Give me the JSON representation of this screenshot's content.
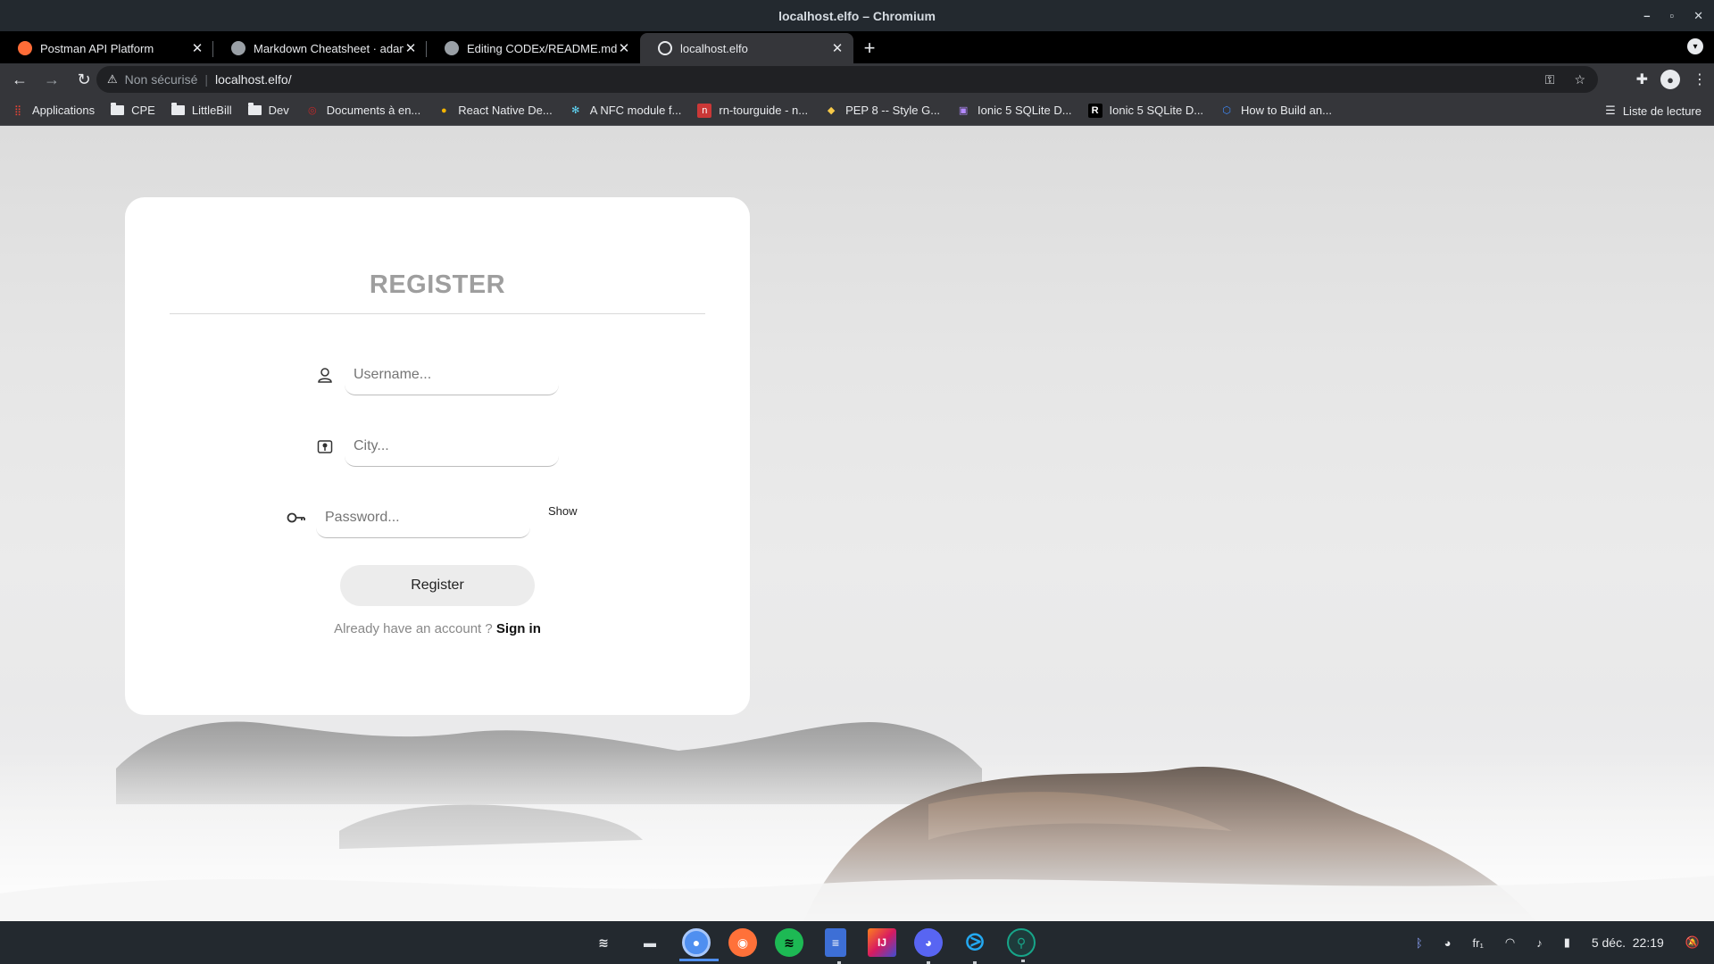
{
  "window": {
    "title": "localhost.elfo – Chromium",
    "controls": [
      "–",
      "▫",
      "✕"
    ]
  },
  "tabs": [
    {
      "label": "Postman API Platform",
      "favicon_color": "#ff6c37",
      "favicon_glyph": "⬤",
      "active": false
    },
    {
      "label": "Markdown Cheatsheet · adam-p/markdown-here",
      "favicon_color": "#24292f",
      "favicon_glyph": "◉",
      "active": false
    },
    {
      "label": "Editing CODEx/README.md at main",
      "favicon_color": "#24292f",
      "favicon_glyph": "◉",
      "active": false
    },
    {
      "label": "localhost.elfo",
      "favicon_color": "#9aa0a6",
      "favicon_glyph": "◍",
      "active": true
    }
  ],
  "omnibox": {
    "security": "Non sécurisé",
    "url": "localhost.elfo/"
  },
  "bookmarks": [
    {
      "label": "Applications",
      "type": "apps"
    },
    {
      "label": "CPE",
      "type": "folder"
    },
    {
      "label": "LittleBill",
      "type": "folder"
    },
    {
      "label": "Dev",
      "type": "folder"
    },
    {
      "label": "Documents à en...",
      "type": "icon",
      "color": "#c62828",
      "glyph": "◎"
    },
    {
      "label": "React Native De...",
      "type": "icon",
      "color": "#f4b400",
      "glyph": "●"
    },
    {
      "label": "A NFC module f...",
      "type": "icon",
      "color": "#61dafb",
      "glyph": "✻"
    },
    {
      "label": "rn-tourguide - n...",
      "type": "icon",
      "color": "#cb3837",
      "glyph": "n"
    },
    {
      "label": "PEP 8 -- Style G...",
      "type": "icon",
      "color": "#3776ab",
      "glyph": "◆"
    },
    {
      "label": "Ionic 5 SQLite D...",
      "type": "icon",
      "color": "#7b1fa2",
      "glyph": "▣"
    },
    {
      "label": "Ionic 5 SQLite D...",
      "type": "icon",
      "color": "#000000",
      "glyph": "R"
    },
    {
      "label": "How to Build an...",
      "type": "icon",
      "color": "#3f8cff",
      "glyph": "⬡"
    }
  ],
  "reading_list": "Liste de lecture",
  "form": {
    "title": "REGISTER",
    "username_placeholder": "Username...",
    "city_placeholder": "City...",
    "password_placeholder": "Password...",
    "show_label": "Show",
    "submit_label": "Register",
    "account_prompt": "Already have an account ?",
    "signin_label": "Sign in"
  },
  "taskbar": {
    "apps": [
      {
        "name": "zorin-menu",
        "color": "#23292f",
        "glyph": "Z"
      },
      {
        "name": "files",
        "color": "#23292f",
        "glyph": "▭"
      },
      {
        "name": "chromium",
        "color": "#4f8ff0",
        "glyph": "◎",
        "active": true
      },
      {
        "name": "firefox",
        "color": "#ff7139",
        "glyph": "◉"
      },
      {
        "name": "spotify",
        "color": "#1db954",
        "glyph": "≋"
      },
      {
        "name": "text-editor",
        "color": "#3d6fd6",
        "glyph": "≡",
        "running": true
      },
      {
        "name": "intellij",
        "color": "#d81b60",
        "glyph": "IJ"
      },
      {
        "name": "discord",
        "color": "#5865f2",
        "glyph": "◕",
        "running": true
      },
      {
        "name": "vscode",
        "color": "#23292f",
        "glyph": "⧁",
        "running": true
      },
      {
        "name": "gitkraken",
        "color": "#1e3b3b",
        "glyph": "⚲",
        "running": true
      }
    ],
    "keyboard_layout": "fr₁",
    "date": "5 déc.",
    "time": "22:19"
  }
}
